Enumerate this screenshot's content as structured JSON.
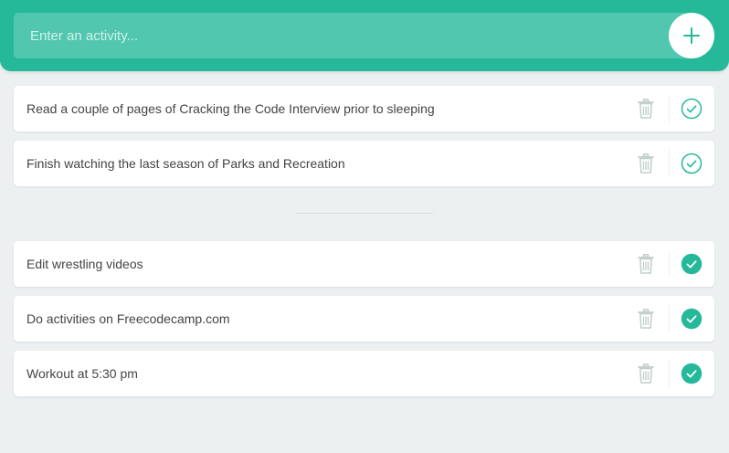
{
  "header": {
    "input_value": "",
    "input_placeholder": "Enter an activity...",
    "add_icon": "plus-icon"
  },
  "todo": {
    "items": [
      {
        "text": "Read a couple of pages of Cracking the Code Interview prior to sleeping"
      },
      {
        "text": "Finish watching the last season of Parks and Recreation"
      }
    ]
  },
  "completed": {
    "items": [
      {
        "text": "Edit wrestling videos"
      },
      {
        "text": "Do activities on Freecodecamp.com"
      },
      {
        "text": "Workout at 5:30 pm"
      }
    ]
  },
  "icons": {
    "delete": "trash-icon",
    "complete_pending": "check-circle-outline-icon",
    "complete_done": "check-circle-filled-icon"
  },
  "colors": {
    "accent": "#25b99a",
    "background": "#edf0f1",
    "text": "#444444",
    "trash": "#c0cecb"
  }
}
